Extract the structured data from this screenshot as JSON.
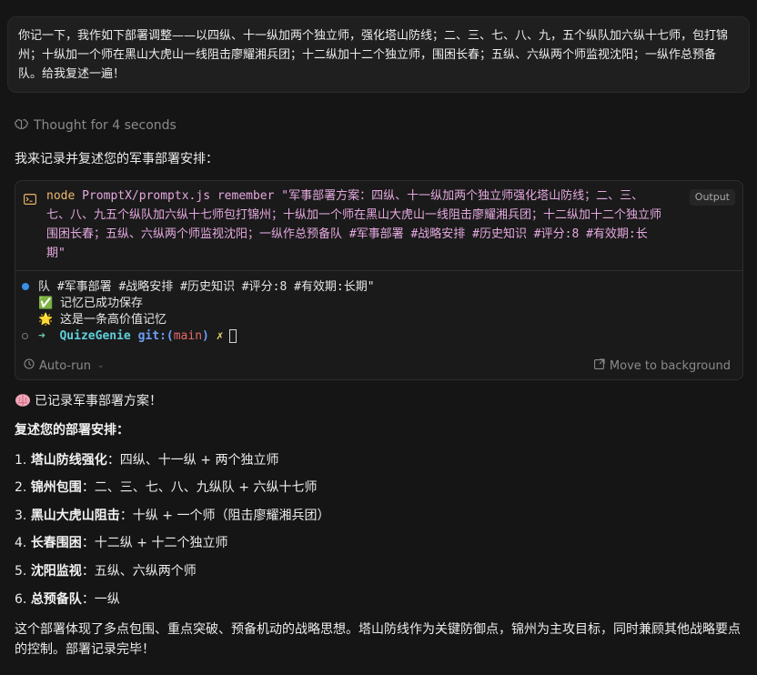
{
  "user_message": "你记一下，我作如下部署调整——以四纵、十一纵加两个独立师，强化塔山防线；二、三、七、八、九，五个纵队加六纵十七师，包打锦州；十纵加一个师在黑山大虎山一线阻击廖耀湘兵团；十二纵加十二个独立师，围困长春；五纵、六纵两个师监视沈阳；一纵作总预备队。给我复述一遍！",
  "thought": {
    "label": "Thought for 4 seconds",
    "icon": "brain-outline-icon"
  },
  "intro": "我来记录并复述您的军事部署安排：",
  "terminal": {
    "icon": "terminal-icon",
    "command_keyword": "node",
    "command_rest": " PromptX/promptx.js remember \"军事部署方案：四纵、十一纵加两个独立师强化塔山防线；二、三、七、八、九五个纵队加六纵十七师包打锦州；十纵加一个师在黑山大虎山一线阻击廖耀湘兵团；十二纵加十二个独立师围困长春；五纵、六纵两个师监视沈阳；一纵作总预备队 #军事部署 #战略安排 #历史知识 #评分:8 #有效期:长期\"",
    "output_button": "Output",
    "lines": {
      "line1": "队 #军事部署 #战略安排 #历史知识 #评分:8 #有效期:长期\"",
      "line1_end": "\"",
      "line2_emoji": "✅",
      "line2": "记忆已成功保存",
      "line3_emoji": "🌟",
      "line3": "这是一条高价值记忆",
      "prompt_arrow": "➜",
      "prompt_dir": "QuizeGenie",
      "prompt_git": "git:(",
      "prompt_branch": "main",
      "prompt_git_close": ")",
      "prompt_x": "✗"
    },
    "autorun_label": "Auto-run",
    "move_bg_label": "Move to background"
  },
  "answer": {
    "heading_icon": "brain-icon",
    "heading": "已记录军事部署方案！",
    "subheading": "复述您的部署安排：",
    "items": [
      {
        "num": "1.",
        "title": "塔山防线强化",
        "desc": "：四纵、十一纵 + 两个独立师"
      },
      {
        "num": "2.",
        "title": "锦州包围",
        "desc": "：二、三、七、八、九纵队 + 六纵十七师"
      },
      {
        "num": "3.",
        "title": "黑山大虎山阻击",
        "desc": "：十纵 + 一个师（阻击廖耀湘兵团）"
      },
      {
        "num": "4.",
        "title": "长春围困",
        "desc": "：十二纵 + 十二个独立师"
      },
      {
        "num": "5.",
        "title": "沈阳监视",
        "desc": "：五纵、六纵两个师"
      },
      {
        "num": "6.",
        "title": "总预备队",
        "desc": "：一纵"
      }
    ],
    "closing": "这个部署体现了多点包围、重点突破、预备机动的战略思想。塔山防线作为关键防御点，锦州为主攻目标，同时兼顾其他战略要点的控制。部署记录完毕！"
  }
}
